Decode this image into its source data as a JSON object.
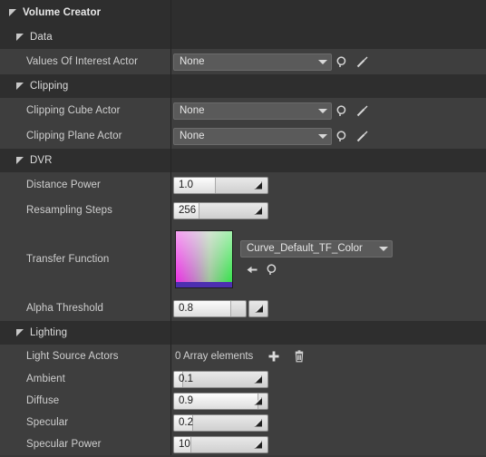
{
  "panel": {
    "title": "Volume Creator",
    "colors": {
      "row_dark": "#2e2e2e",
      "row_light": "#3e3e3e",
      "panel_bg": "#383838",
      "text": "#cfcfcf",
      "field_fill": "#e9e9e9"
    }
  },
  "sections": [
    {
      "name": "Volume Creator",
      "type": "root-category",
      "expanded": true
    },
    {
      "name": "Data",
      "type": "category",
      "expanded": true,
      "properties": [
        {
          "label": "Values Of Interest Actor",
          "kind": "object-picker",
          "value": "None",
          "buttons": [
            "browse-icon",
            "eyedropper-icon"
          ]
        }
      ]
    },
    {
      "name": "Clipping",
      "type": "category",
      "expanded": true,
      "properties": [
        {
          "label": "Clipping Cube Actor",
          "kind": "object-picker",
          "value": "None",
          "buttons": [
            "browse-icon",
            "eyedropper-icon"
          ]
        },
        {
          "label": "Clipping Plane Actor",
          "kind": "object-picker",
          "value": "None",
          "buttons": [
            "browse-icon",
            "eyedropper-icon"
          ]
        }
      ]
    },
    {
      "name": "DVR",
      "type": "category",
      "expanded": true,
      "properties": [
        {
          "label": "Distance Power",
          "kind": "number-slider",
          "value": "1.0",
          "fill_percent": 45
        },
        {
          "label": "Resampling Steps",
          "kind": "number-slider",
          "value": "256",
          "fill_percent": 27
        },
        {
          "label": "Transfer Function",
          "kind": "asset-thumbnail",
          "value": "Curve_Default_TF_Color",
          "thumbnail": "gradient-magenta-green",
          "buttons": [
            "use-selected-arrow-icon",
            "browse-icon"
          ]
        },
        {
          "label": "Alpha Threshold",
          "kind": "number-slider",
          "value": "0.8",
          "fill_percent": 80
        }
      ]
    },
    {
      "name": "Lighting",
      "type": "category",
      "expanded": true,
      "properties": [
        {
          "label": "Light Source Actors",
          "kind": "array",
          "value": "0 Array elements",
          "buttons": [
            "add-element-icon",
            "delete-all-icon"
          ]
        },
        {
          "label": "Ambient",
          "kind": "number-slider",
          "value": "0.1",
          "fill_percent": 10
        },
        {
          "label": "Diffuse",
          "kind": "number-slider",
          "value": "0.9",
          "fill_percent": 90
        },
        {
          "label": "Specular",
          "kind": "number-slider",
          "value": "0.2",
          "fill_percent": 20
        },
        {
          "label": "Specular Power",
          "kind": "number-slider",
          "value": "10",
          "fill_percent": 18
        }
      ]
    }
  ]
}
